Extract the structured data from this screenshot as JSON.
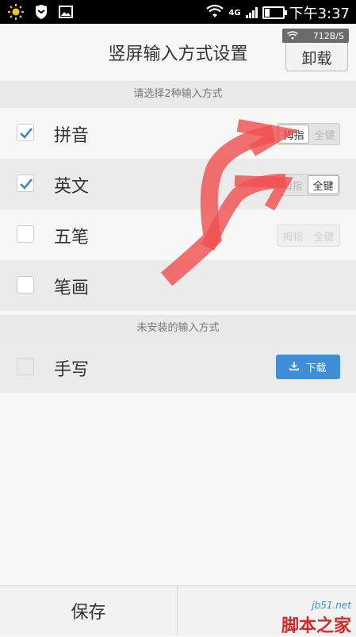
{
  "status_bar": {
    "network_label": "4G",
    "time": "下午3:37",
    "icons": [
      "brightness-icon",
      "shield-icon",
      "image-icon",
      "wifi-icon",
      "signal-icon",
      "battery-icon"
    ]
  },
  "header": {
    "title": "竖屏输入方式设置",
    "speed": "712B/S",
    "uninstall_label": "卸载"
  },
  "sections": {
    "choose": "请选择2种输入方式",
    "not_installed": "未安装的输入方式"
  },
  "methods": [
    {
      "label": "拼音",
      "checked": true,
      "toggle": [
        "拇指",
        "全键"
      ],
      "selected": "拇指"
    },
    {
      "label": "英文",
      "checked": true,
      "toggle": [
        "拇指",
        "全键"
      ],
      "selected": "全键"
    },
    {
      "label": "五笔",
      "checked": false,
      "toggle": [
        "拇指",
        "全键"
      ],
      "selected": ""
    },
    {
      "label": "笔画",
      "checked": false
    }
  ],
  "uninstalled": [
    {
      "label": "手写",
      "download_label": "下载"
    }
  ],
  "footer": {
    "save_label": "保存"
  },
  "watermark": {
    "url": "jb51.net",
    "text": "脚本之家"
  },
  "colors": {
    "accent": "#3f8fd6",
    "check": "#3a86d0",
    "overlay_arrow": "#f05050"
  }
}
